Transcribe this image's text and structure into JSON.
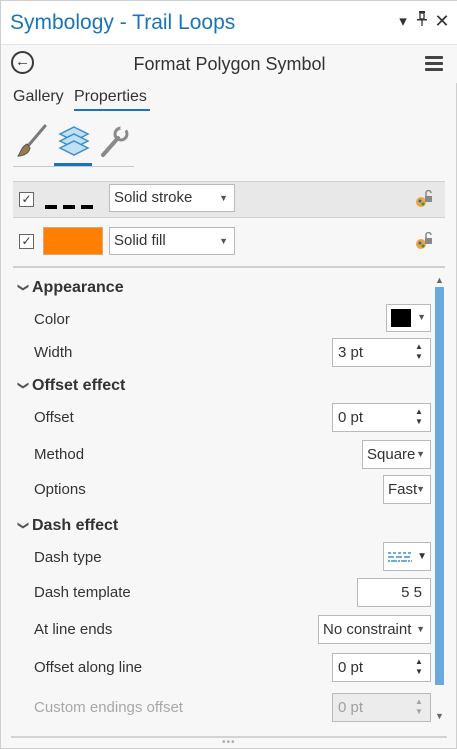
{
  "window": {
    "title": "Symbology - Trail Loops",
    "menu_icon": "dropdown-arrow-icon",
    "pin_icon": "pin-icon",
    "close_icon": "close-icon"
  },
  "header": {
    "title": "Format Polygon Symbol",
    "back_icon": "back-arrow-icon",
    "menu_icon": "hamburger-menu-icon"
  },
  "tabs": [
    {
      "label": "Gallery",
      "active": false
    },
    {
      "label": "Properties",
      "active": true
    }
  ],
  "icon_tabs": [
    {
      "name": "symbol-paintbrush-icon",
      "active": false
    },
    {
      "name": "layers-icon",
      "active": true
    },
    {
      "name": "wrench-icon",
      "active": false
    }
  ],
  "layers": [
    {
      "checked": true,
      "type": "Solid stroke",
      "preview": "dashed-line"
    },
    {
      "checked": true,
      "type": "Solid fill",
      "preview": "orange-fill",
      "color": "#ff7f00"
    }
  ],
  "sections": {
    "appearance": {
      "title": "Appearance",
      "color_label": "Color",
      "color_value": "#000000",
      "width_label": "Width",
      "width_value": "3 pt"
    },
    "offset_effect": {
      "title": "Offset effect",
      "offset_label": "Offset",
      "offset_value": "0 pt",
      "method_label": "Method",
      "method_value": "Square",
      "options_label": "Options",
      "options_value": "Fast"
    },
    "dash_effect": {
      "title": "Dash effect",
      "dash_type_label": "Dash type",
      "dash_template_label": "Dash template",
      "dash_template_value": "5 5",
      "at_line_ends_label": "At line ends",
      "at_line_ends_value": "No constraint",
      "offset_along_line_label": "Offset along line",
      "offset_along_line_value": "0 pt",
      "custom_endings_offset_label": "Custom endings offset",
      "custom_endings_offset_value": "0 pt"
    }
  },
  "colors": {
    "accent": "#1b74b8",
    "scroll_thumb": "#6aa9dc",
    "fill_swatch": "#ff7f00"
  }
}
